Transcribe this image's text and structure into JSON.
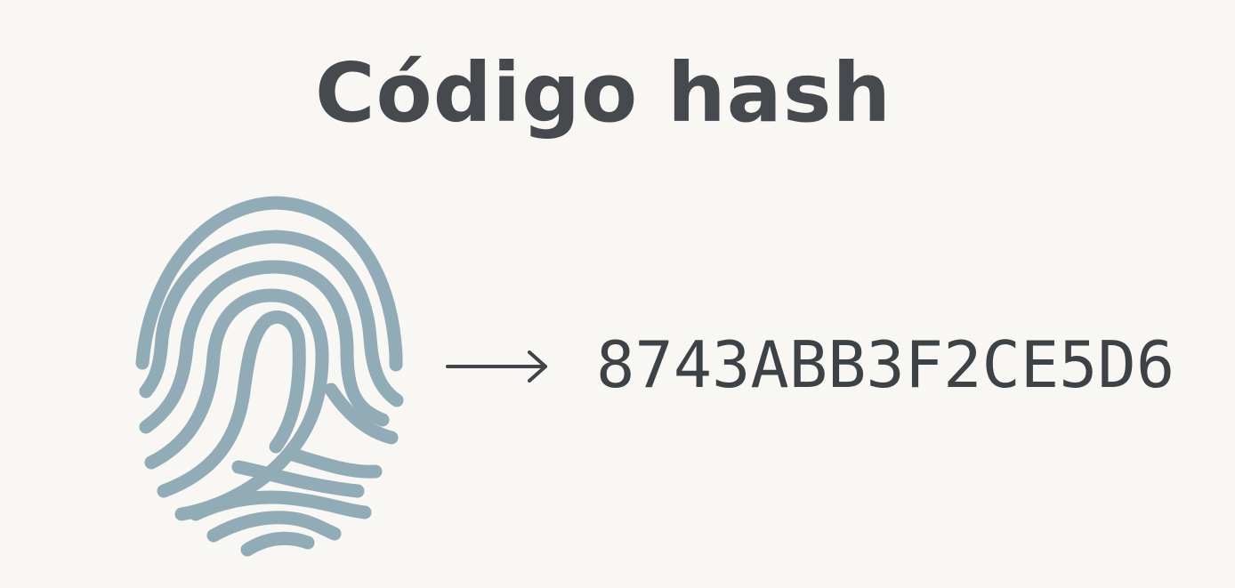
{
  "title": "Código hash",
  "hash_value": "8743ABB3F2CE5D6",
  "icons": {
    "fingerprint": "fingerprint-icon",
    "arrow": "arrow-right-icon"
  },
  "colors": {
    "background": "#f9f7f3",
    "title": "#464a4f",
    "fingerprint": "#91abb7",
    "arrow": "#3f4448",
    "hash": "#3d4247"
  }
}
